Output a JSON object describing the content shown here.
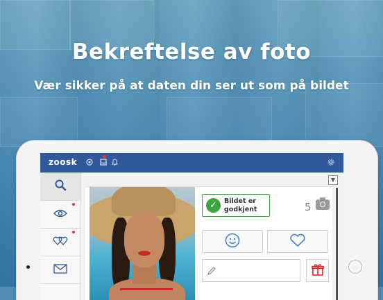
{
  "promo": {
    "headline": "Bekreftelse av foto",
    "subline": "Vær sikker på at daten din ser ut som på bildet"
  },
  "app": {
    "logo": "zoosk",
    "brand_color": "#2e5a9c",
    "topbar_icons": [
      "coin-icon",
      "inbox-icon",
      "bell-icon",
      "gear-icon"
    ]
  },
  "sidebar": {
    "items": [
      {
        "icon": "search-icon",
        "active": true,
        "notification": false
      },
      {
        "icon": "eye-icon",
        "active": false,
        "notification": true
      },
      {
        "icon": "hearts-icon",
        "active": false,
        "notification": true
      },
      {
        "icon": "mail-icon",
        "active": false,
        "notification": false
      }
    ]
  },
  "profile": {
    "verified_badge": "Bildet er godkjent",
    "photo_count": "5",
    "verified_color": "#3aa63a",
    "gift_color": "#d3202a"
  }
}
